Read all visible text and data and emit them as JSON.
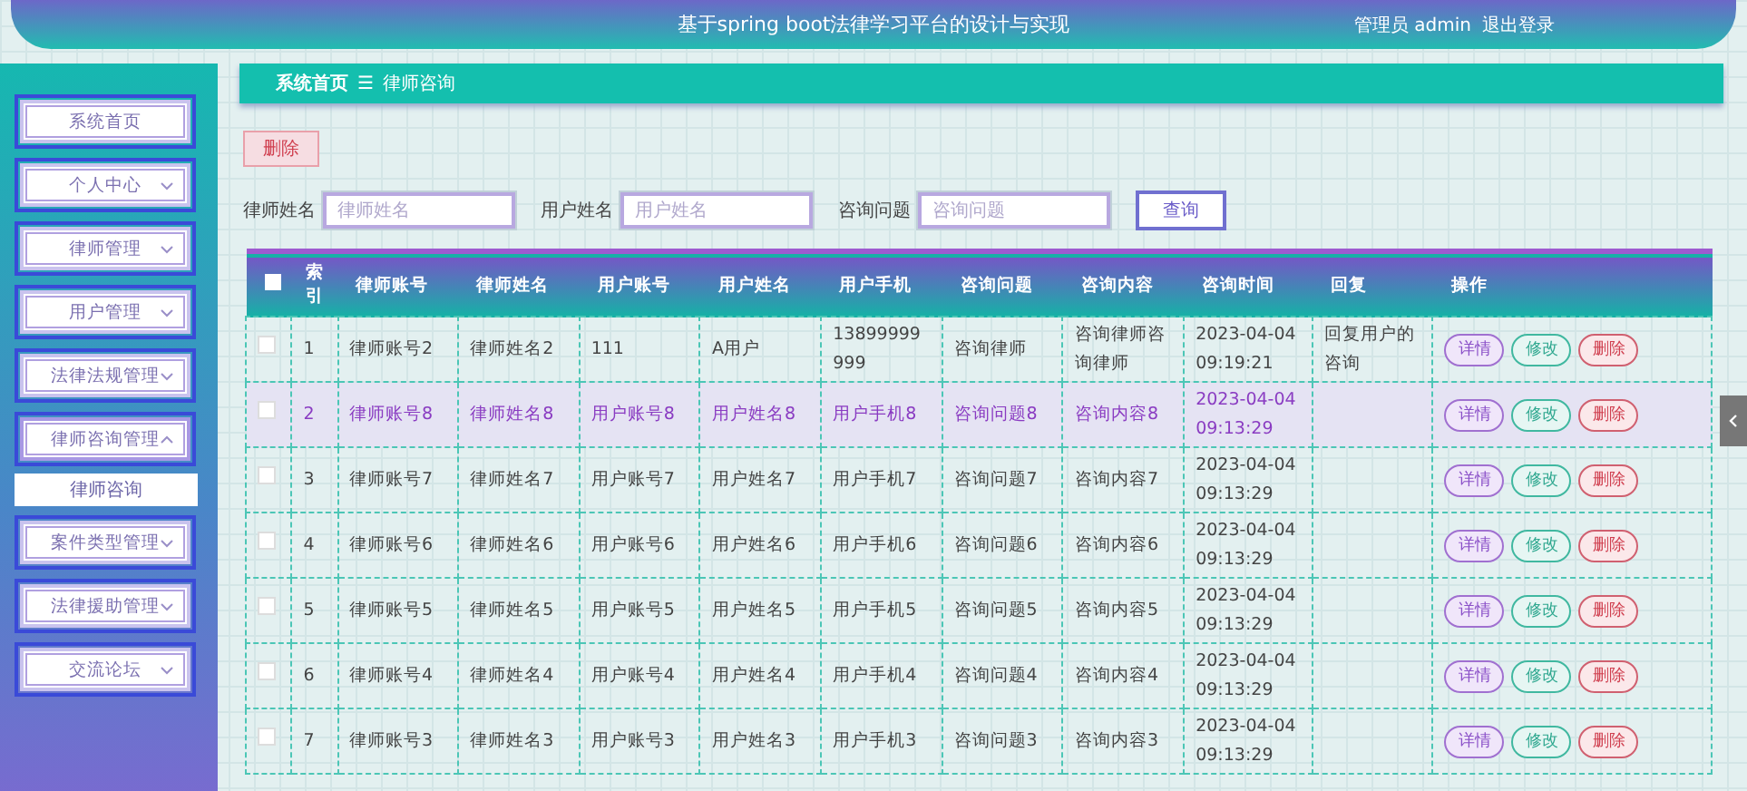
{
  "header": {
    "title": "基于spring boot法律学习平台的设计与实现",
    "user": "管理员 admin",
    "logout": "退出登录"
  },
  "sidebar": {
    "items": [
      {
        "label": "系统首页",
        "kind": "link"
      },
      {
        "label": "个人中心",
        "kind": "menu",
        "expanded": false
      },
      {
        "label": "律师管理",
        "kind": "menu",
        "expanded": false
      },
      {
        "label": "用户管理",
        "kind": "menu",
        "expanded": false
      },
      {
        "label": "法律法规管理",
        "kind": "menu",
        "expanded": false
      },
      {
        "label": "律师咨询管理",
        "kind": "menu",
        "expanded": true,
        "children": [
          {
            "label": "律师咨询"
          }
        ]
      },
      {
        "label": "案件类型管理",
        "kind": "menu",
        "expanded": false
      },
      {
        "label": "法律援助管理",
        "kind": "menu",
        "expanded": false
      },
      {
        "label": "交流论坛",
        "kind": "menu",
        "expanded": false
      }
    ]
  },
  "breadcrumb": {
    "home": "系统首页",
    "separator": "☰",
    "current": "律师咨询"
  },
  "toolbar": {
    "delete": "删除"
  },
  "search": {
    "fields": [
      {
        "label": "律师姓名",
        "placeholder": "律师姓名"
      },
      {
        "label": "用户姓名",
        "placeholder": "用户姓名"
      },
      {
        "label": "咨询问题",
        "placeholder": "咨询问题"
      }
    ],
    "button": "查询"
  },
  "table": {
    "select_all_checked": false,
    "columns": [
      "",
      "索引",
      "律师账号",
      "律师姓名",
      "用户账号",
      "用户姓名",
      "用户手机",
      "咨询问题",
      "咨询内容",
      "咨询时间",
      "回复",
      "操作"
    ],
    "rows": [
      {
        "cells": [
          "",
          "1",
          "律师账号2",
          "律师姓名2",
          "111",
          "A用户",
          "13899999999",
          "咨询律师",
          "咨询律师咨询律师",
          "2023-04-04 09:19:21",
          "回复用户的咨询"
        ],
        "actions": [
          "详情",
          "修改",
          "删除"
        ],
        "checked": false,
        "highlighted": false
      },
      {
        "cells": [
          "",
          "2",
          "律师账号8",
          "律师姓名8",
          "用户账号8",
          "用户姓名8",
          "用户手机8",
          "咨询问题8",
          "咨询内容8",
          "2023-04-04 09:13:29",
          ""
        ],
        "actions": [
          "详情",
          "修改",
          "删除"
        ],
        "checked": false,
        "highlighted": true
      },
      {
        "cells": [
          "",
          "3",
          "律师账号7",
          "律师姓名7",
          "用户账号7",
          "用户姓名7",
          "用户手机7",
          "咨询问题7",
          "咨询内容7",
          "2023-04-04 09:13:29",
          ""
        ],
        "actions": [
          "详情",
          "修改",
          "删除"
        ],
        "checked": false,
        "highlighted": false
      },
      {
        "cells": [
          "",
          "4",
          "律师账号6",
          "律师姓名6",
          "用户账号6",
          "用户姓名6",
          "用户手机6",
          "咨询问题6",
          "咨询内容6",
          "2023-04-04 09:13:29",
          ""
        ],
        "actions": [
          "详情",
          "修改",
          "删除"
        ],
        "checked": false,
        "highlighted": false
      },
      {
        "cells": [
          "",
          "5",
          "律师账号5",
          "律师姓名5",
          "用户账号5",
          "用户姓名5",
          "用户手机5",
          "咨询问题5",
          "咨询内容5",
          "2023-04-04 09:13:29",
          ""
        ],
        "actions": [
          "详情",
          "修改",
          "删除"
        ],
        "checked": false,
        "highlighted": false
      },
      {
        "cells": [
          "",
          "6",
          "律师账号4",
          "律师姓名4",
          "用户账号4",
          "用户姓名4",
          "用户手机4",
          "咨询问题4",
          "咨询内容4",
          "2023-04-04 09:13:29",
          ""
        ],
        "actions": [
          "详情",
          "修改",
          "删除"
        ],
        "checked": false,
        "highlighted": false
      },
      {
        "cells": [
          "",
          "7",
          "律师账号3",
          "律师姓名3",
          "用户账号3",
          "用户姓名3",
          "用户手机3",
          "咨询问题3",
          "咨询内容3",
          "2023-04-04 09:13:29",
          ""
        ],
        "actions": [
          "详情",
          "修改",
          "删除"
        ],
        "checked": false,
        "highlighted": false
      }
    ]
  }
}
